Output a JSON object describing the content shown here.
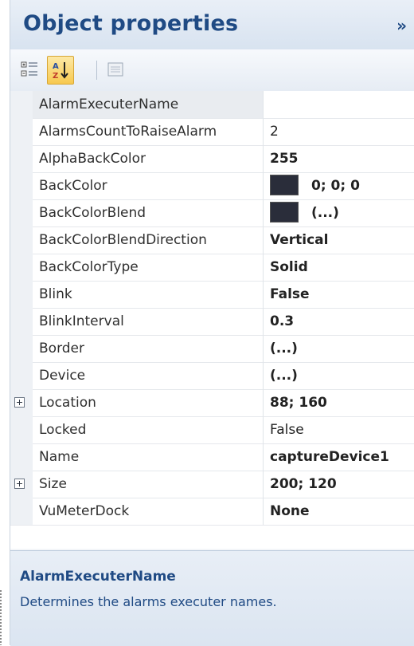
{
  "panel": {
    "title": "Object properties",
    "collapse_glyph": "»"
  },
  "toolbar": {
    "buttons": [
      {
        "icon": "categorized-icon",
        "active": false
      },
      {
        "icon": "sort-alphabetical-icon",
        "active": true
      },
      {
        "icon": "property-pages-icon",
        "active": false
      }
    ]
  },
  "grid": {
    "rows": [
      {
        "name": "AlarmExecuterName",
        "value": "",
        "bold": false,
        "selected": true
      },
      {
        "name": "AlarmsCountToRaiseAlarm",
        "value": "2",
        "bold": false
      },
      {
        "name": "AlphaBackColor",
        "value": "255",
        "bold": true
      },
      {
        "name": "BackColor",
        "value": "0; 0; 0",
        "bold": true,
        "swatch": "#2a2d3a"
      },
      {
        "name": "BackColorBlend",
        "value": "(...)",
        "bold": true,
        "swatch": "#2a2d3a"
      },
      {
        "name": "BackColorBlendDirection",
        "value": "Vertical",
        "bold": true
      },
      {
        "name": "BackColorType",
        "value": "Solid",
        "bold": true
      },
      {
        "name": "Blink",
        "value": "False",
        "bold": true
      },
      {
        "name": "BlinkInterval",
        "value": "0.3",
        "bold": true
      },
      {
        "name": "Border",
        "value": "(...)",
        "bold": true
      },
      {
        "name": "Device",
        "value": "(...)",
        "bold": true
      },
      {
        "name": "Location",
        "value": "88; 160",
        "bold": true,
        "expandable": true
      },
      {
        "name": "Locked",
        "value": "False",
        "bold": false
      },
      {
        "name": "Name",
        "value": "captureDevice1",
        "bold": true
      },
      {
        "name": "Size",
        "value": "200; 120",
        "bold": true,
        "expandable": true
      },
      {
        "name": "VuMeterDock",
        "value": "None",
        "bold": true
      }
    ]
  },
  "description": {
    "title": "AlarmExecuterName",
    "text": "Determines the alarms executer names."
  },
  "colors": {
    "accent": "#1f4a84",
    "swatch": "#2a2d3a"
  }
}
